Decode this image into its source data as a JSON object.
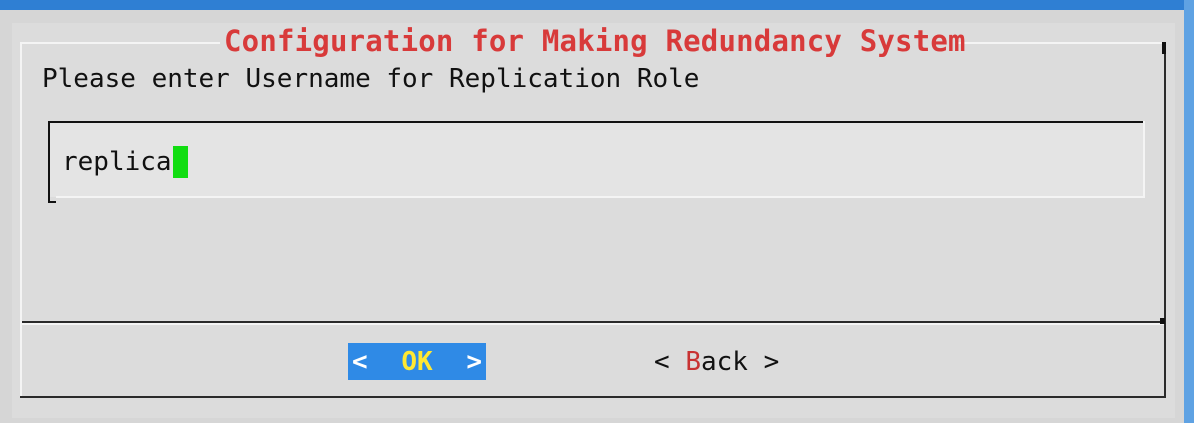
{
  "dialog": {
    "title": "Configuration for Making Redundancy System",
    "prompt": "Please enter Username for Replication Role",
    "input": {
      "value": "replica"
    },
    "buttons": {
      "ok": {
        "left_bracket": "<",
        "label": "OK",
        "right_bracket": ">"
      },
      "back": {
        "left_bracket": "<",
        "label_first": "B",
        "label_rest": "ack",
        "right_bracket": ">"
      }
    }
  },
  "colors": {
    "screen_background": "#3c8ad6",
    "dialog_background": "#d6d6d6",
    "title_text": "#d83a3a",
    "cursor": "#11dd11",
    "selected_button": "#2f8ae6",
    "selected_label": "#ffe833",
    "hotkey": "#c83232"
  }
}
